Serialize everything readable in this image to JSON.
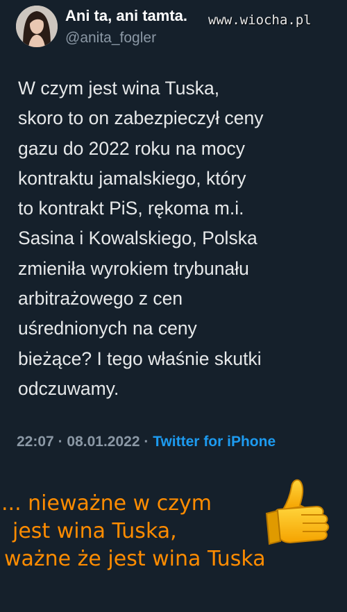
{
  "tweet": {
    "display_name": "Ani ta, ani tamta.",
    "handle": "@anita_fogler",
    "text_lines": [
      "W czym jest wina Tuska,",
      "skoro to on zabezpieczył ceny",
      "gazu do 2022 roku na mocy",
      "kontraktu jamalskiego, który",
      "to kontrakt PiS, rękoma m.i.",
      "Sasina i Kowalskiego, Polska",
      "zmieniła wyrokiem trybunału",
      "arbitrażowego z cen",
      "uśrednionych na ceny",
      "bieżące? I tego właśnie skutki",
      "odczuwamy."
    ],
    "time": "22:07",
    "separator": "·",
    "date": "08.01.2022",
    "source": "Twitter for iPhone"
  },
  "watermark": "www.wiocha.pl",
  "caption": {
    "line1": "... nieważne w czym",
    "line2": "jest wina Tuska,",
    "line3": "ważne że jest wina Tuska"
  },
  "icons": {
    "thumb": "thumbs-up-icon"
  },
  "colors": {
    "background": "#15202b",
    "text": "#e7e9ea",
    "muted": "#8b98a5",
    "link": "#1d9bf0",
    "caption": "#ff8c00"
  }
}
